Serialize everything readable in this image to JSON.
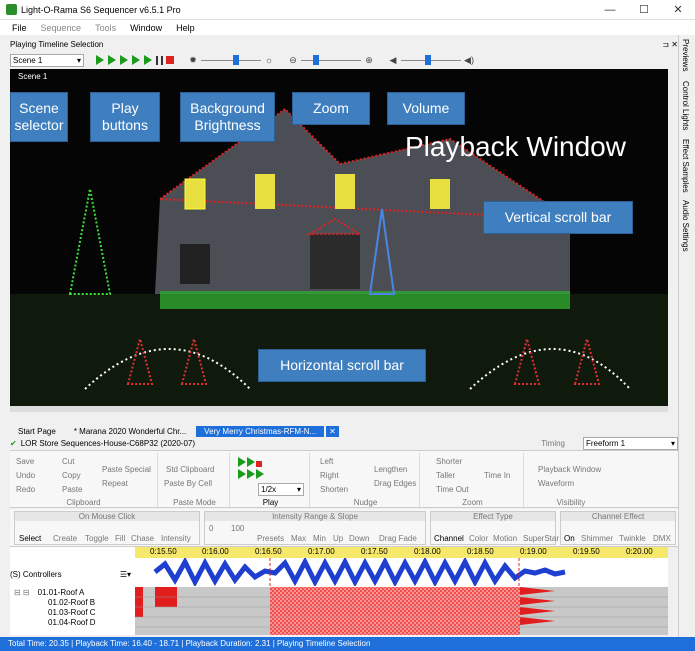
{
  "window": {
    "title": "Light-O-Rama S6 Sequencer v6.5.1 Pro",
    "min": "—",
    "max": "☐",
    "close": "✕"
  },
  "menu": [
    "File",
    "Sequence",
    "Tools",
    "Window",
    "Help"
  ],
  "side_tabs": [
    "Previews",
    "Control Lights",
    "Effect Samples",
    "Audio Settings"
  ],
  "panel": {
    "title": "Playing Timeline Selection",
    "pin": "⊐ ✕"
  },
  "toolbar": {
    "scene_value": "Scene 1",
    "brightness_level": 0.58,
    "zoom_level": 0.25,
    "volume_level": 0.45
  },
  "playback": {
    "scene_label": "Scene 1",
    "title": "Playback Window",
    "callouts": {
      "scene": "Scene selector",
      "play": "Play buttons",
      "brightness": "Background Brightness",
      "zoom": "Zoom",
      "volume": "Volume",
      "vscroll": "Vertical scroll bar",
      "hscroll": "Horizontal scroll bar"
    }
  },
  "doc_tabs": [
    {
      "label": "Start Page"
    },
    {
      "label": "* Marana 2020 Wonderful Chr..."
    },
    {
      "label": "Very Merry Christmas-RFM-N..."
    },
    {
      "label": "✕"
    }
  ],
  "seqbar": {
    "sequence_name": "LOR Store Sequences-House-C68P32 (2020-07)",
    "timing_label": "Timing",
    "timing_value": "Freeform 1"
  },
  "ribbon": {
    "clipboard": {
      "label": "Clipboard",
      "items": [
        "Save",
        "Undo",
        "Redo",
        "Cut",
        "Copy",
        "Paste",
        "Paste Special",
        "Repeat"
      ]
    },
    "paste_mode": {
      "label": "Paste Mode",
      "items": [
        "Std Clipboard",
        "Paste By Cell"
      ]
    },
    "play": {
      "label": "Play",
      "speed": "1/2x"
    },
    "nudge": {
      "label": "Nudge",
      "items": [
        "Left",
        "Right",
        "Shorten",
        "Lengthen",
        "Drag Edges"
      ]
    },
    "zoom": {
      "label": "Zoom",
      "items": [
        "Shorter",
        "Taller",
        "Time Out",
        "Time In"
      ]
    },
    "visibility": {
      "label": "Visibility",
      "items": [
        "Playback Window",
        "Waveform"
      ]
    }
  },
  "ribbon2": {
    "on_mouse_click": {
      "label": "On Mouse Click",
      "items": [
        "Select",
        "Create",
        "Toggle",
        "Fill",
        "Chase",
        "Intensity"
      ]
    },
    "intensity_range": {
      "label": "Intensity Range & Slope",
      "min_value": "0",
      "max_value": "100",
      "items": [
        "Presets",
        "Max",
        "Min",
        "Up",
        "Down",
        "Drag Fade"
      ]
    },
    "effect_type": {
      "label": "Effect Type",
      "items": [
        "Channel",
        "Color",
        "Motion",
        "SuperStar"
      ]
    },
    "channel_effect": {
      "label": "Channel Effect",
      "items": [
        "On",
        "Shimmer",
        "Twinkle",
        "DMX"
      ]
    }
  },
  "timeline": {
    "ticks": [
      "0:15.50",
      "0:16.00",
      "0:16.50",
      "0:17.00",
      "0:17.50",
      "0:18.00",
      "0:18.50",
      "0:19.00",
      "0:19.50",
      "0:20.00"
    ],
    "group": "(S) Controllers",
    "channels": [
      "01.01-Roof A",
      "01.02-Roof B",
      "01.03-Roof C",
      "01.04-Roof D"
    ]
  },
  "status": "Total Time: 20.35 | Playback Time: 16.40 - 18.71 | Playback Duration: 2.31 | Playing Timeline Selection"
}
